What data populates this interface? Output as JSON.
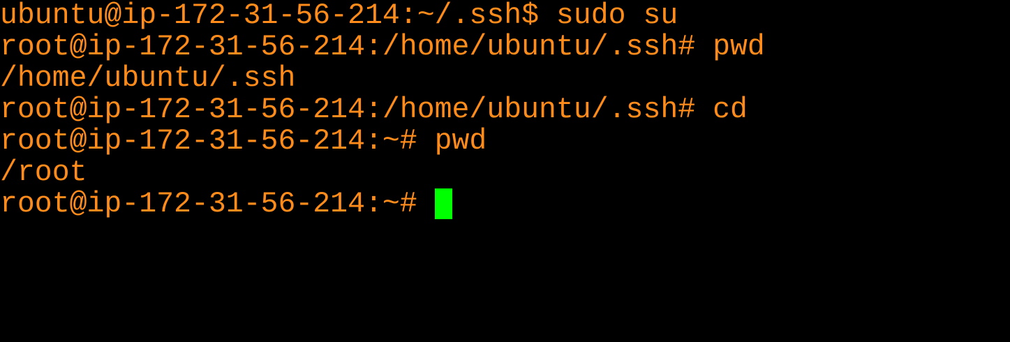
{
  "terminal": {
    "colors": {
      "background": "#000000",
      "text": "#ff8c1a",
      "cursor": "#00ff00"
    },
    "lines": [
      "ubuntu@ip-172-31-56-214:~/.ssh$ sudo su",
      "root@ip-172-31-56-214:/home/ubuntu/.ssh# pwd",
      "/home/ubuntu/.ssh",
      "root@ip-172-31-56-214:/home/ubuntu/.ssh# cd",
      "root@ip-172-31-56-214:~# pwd",
      "/root",
      "root@ip-172-31-56-214:~# "
    ]
  }
}
